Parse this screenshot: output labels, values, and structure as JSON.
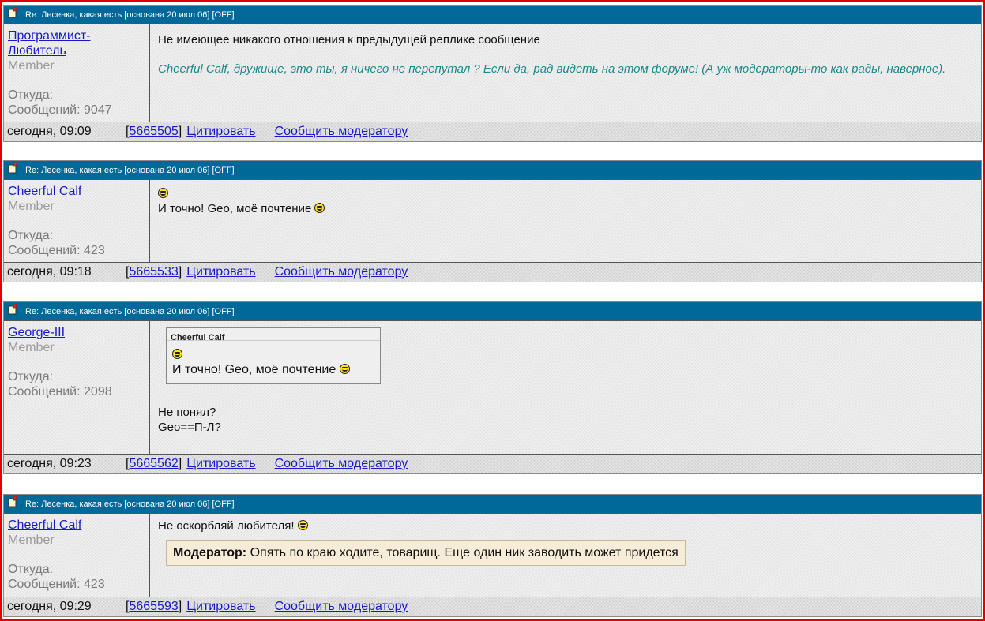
{
  "topic_title": "Re: Лесенка, какая есть [основана 20 июл 06] [OFF]",
  "labels": {
    "origin": "Откуда:",
    "messages_prefix": "Сообщений:",
    "quote_link": "Цитировать",
    "report_link": "Сообщить модератору"
  },
  "posts": [
    {
      "author": "Программист-Любитель",
      "role": "Member",
      "messages": "9047",
      "text": "Не имеющее никакого отношения к предыдущей реплике сообщение",
      "italic_text": "Cheerful Calf, дружище, это ты, я ничего не перепутал ? Если да, рад видеть на этом форуме! (А уж модераторы-то как рады, наверное).",
      "date": "сегодня, 09:09",
      "post_id": "5665505"
    },
    {
      "author": "Cheerful Calf",
      "role": "Member",
      "messages": "423",
      "text": "И точно! Geo, моё почтение",
      "date": "сегодня, 09:18",
      "post_id": "5665533"
    },
    {
      "author": "George-III",
      "role": "Member",
      "messages": "2098",
      "quote_author": "Cheerful Calf",
      "quote_text": "И точно! Geo, моё почтение",
      "text_line1": "Не понял?",
      "text_line2": "Geo==П-Л?",
      "date": "сегодня, 09:23",
      "post_id": "5665562"
    },
    {
      "author": "Cheerful Calf",
      "role": "Member",
      "messages": "423",
      "text": "Не оскорбляй любителя!",
      "mod_label": "Модератор:",
      "mod_text": "Опять по краю ходите, товарищ. Еще один ник заводить может придется",
      "date": "сегодня, 09:29",
      "post_id": "5665593"
    }
  ]
}
